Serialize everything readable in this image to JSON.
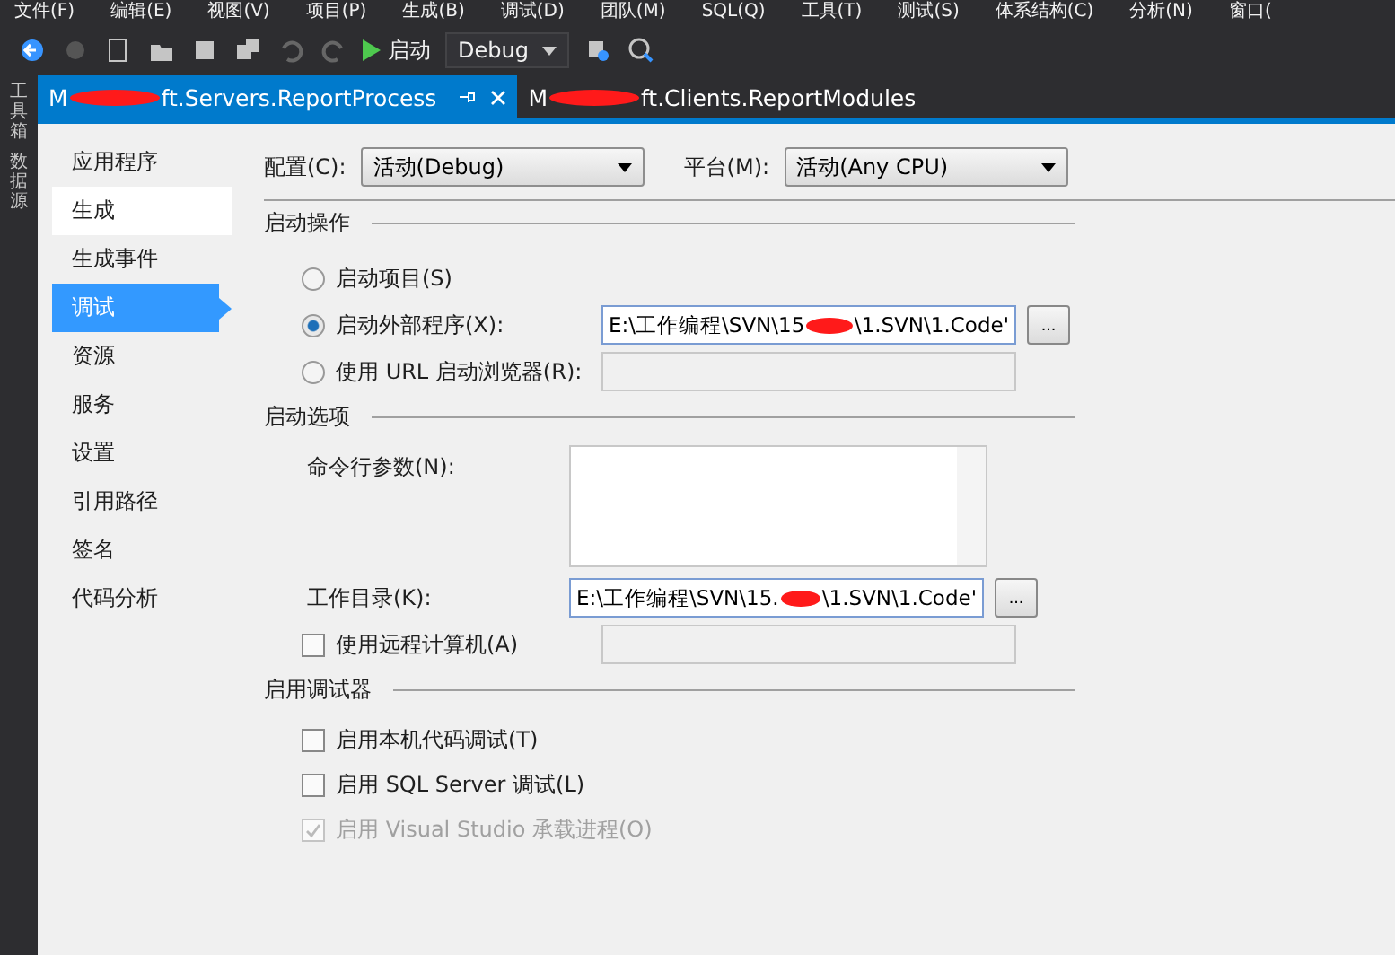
{
  "menu": [
    "文件(F)",
    "编辑(E)",
    "视图(V)",
    "项目(P)",
    "生成(B)",
    "调试(D)",
    "团队(M)",
    "SQL(Q)",
    "工具(T)",
    "测试(S)",
    "体系结构(C)",
    "分析(N)",
    "窗口("
  ],
  "toolbar": {
    "run_label": "启动",
    "config": "Debug"
  },
  "side_panels": [
    "工具箱",
    "数据源"
  ],
  "doc_tabs": [
    {
      "prefix": "M",
      "suffix": "ft.Servers.ReportProcess",
      "selected": true,
      "redacted": true
    },
    {
      "prefix": "M",
      "suffix": "ft.Clients.ReportModules",
      "selected": false,
      "redacted": true
    }
  ],
  "nav": [
    {
      "label": "应用程序",
      "selected": false,
      "hover": false
    },
    {
      "label": "生成",
      "selected": false,
      "hover": true
    },
    {
      "label": "生成事件",
      "selected": false,
      "hover": false
    },
    {
      "label": "调试",
      "selected": true,
      "hover": false
    },
    {
      "label": "资源",
      "selected": false,
      "hover": false
    },
    {
      "label": "服务",
      "selected": false,
      "hover": false
    },
    {
      "label": "设置",
      "selected": false,
      "hover": false
    },
    {
      "label": "引用路径",
      "selected": false,
      "hover": false
    },
    {
      "label": "签名",
      "selected": false,
      "hover": false
    },
    {
      "label": "代码分析",
      "selected": false,
      "hover": false
    }
  ],
  "config": {
    "label": "配置(C):",
    "value": "活动(Debug)"
  },
  "platform": {
    "label": "平台(M):",
    "value": "活动(Any CPU)"
  },
  "start_action": {
    "title": "启动操作",
    "options": [
      {
        "label": "启动项目(S)",
        "selected": false,
        "kind": "plain"
      },
      {
        "label": "启动外部程序(X):",
        "selected": true,
        "kind": "path",
        "value_start": "E:\\工作编程\\SVN\\15",
        "value_end": "\\1.SVN\\1.Code'",
        "browse": "..."
      },
      {
        "label": "使用 URL 启动浏览器(R):",
        "selected": false,
        "kind": "field"
      }
    ]
  },
  "start_options": {
    "title": "启动选项",
    "args_label": "命令行参数(N):",
    "workdir_label": "工作目录(K):",
    "workdir_start": "E:\\工作编程\\SVN\\15.",
    "workdir_end": "\\1.SVN\\1.Code'",
    "browse": "...",
    "remote": {
      "label": "使用远程计算机(A)",
      "checked": false
    }
  },
  "debuggers": {
    "title": "启用调试器",
    "items": [
      {
        "label": "启用本机代码调试(T)",
        "checked": false,
        "disabled": false
      },
      {
        "label": "启用 SQL Server 调试(L)",
        "checked": false,
        "disabled": false
      },
      {
        "label": "启用 Visual Studio 承载进程(O)",
        "checked": true,
        "disabled": true
      }
    ]
  }
}
